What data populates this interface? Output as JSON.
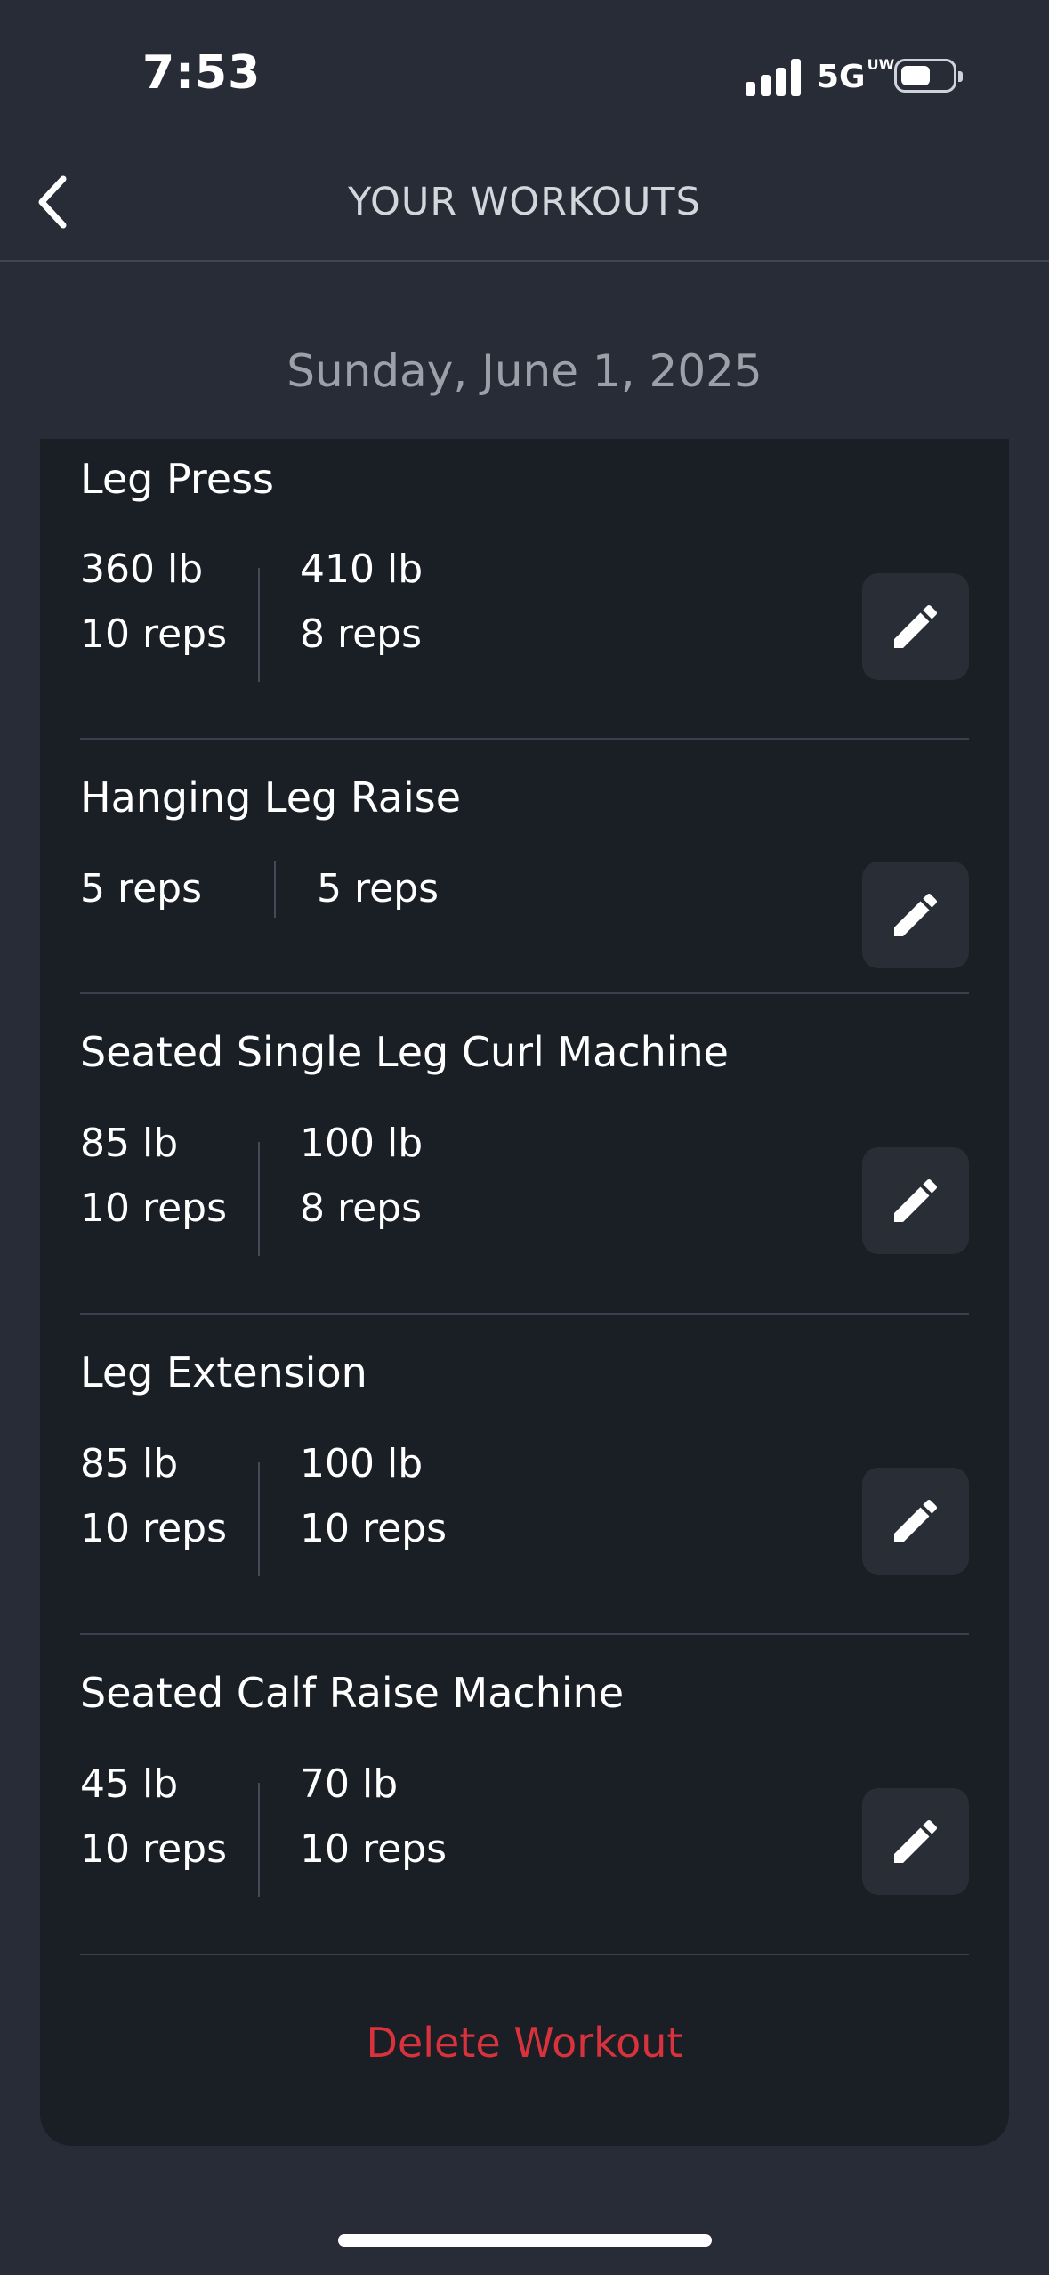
{
  "status": {
    "time": "7:53",
    "network": "5G",
    "network_sub": "UW"
  },
  "nav": {
    "title": "YOUR WORKOUTS"
  },
  "date": "Sunday, June 1, 2025",
  "exercises": [
    {
      "name": "Leg Press",
      "sets": [
        {
          "weight": "360 lb",
          "reps": "10 reps"
        },
        {
          "weight": "410 lb",
          "reps": "8 reps"
        }
      ]
    },
    {
      "name": "Hanging Leg Raise",
      "sets": [
        {
          "reps": "5 reps"
        },
        {
          "reps": "5 reps"
        }
      ]
    },
    {
      "name": "Seated Single Leg Curl Machine",
      "sets": [
        {
          "weight": "85 lb",
          "reps": "10 reps"
        },
        {
          "weight": "100 lb",
          "reps": "8 reps"
        }
      ]
    },
    {
      "name": "Leg Extension",
      "sets": [
        {
          "weight": "85 lb",
          "reps": "10 reps"
        },
        {
          "weight": "100 lb",
          "reps": "10 reps"
        }
      ]
    },
    {
      "name": "Seated Calf Raise Machine",
      "sets": [
        {
          "weight": "45 lb",
          "reps": "10 reps"
        },
        {
          "weight": "70 lb",
          "reps": "10 reps"
        }
      ]
    }
  ],
  "delete_label": "Delete Workout",
  "colors": {
    "background": "#272c37",
    "card": "#1a1e25",
    "button": "#282d36",
    "danger": "#d8323d"
  }
}
